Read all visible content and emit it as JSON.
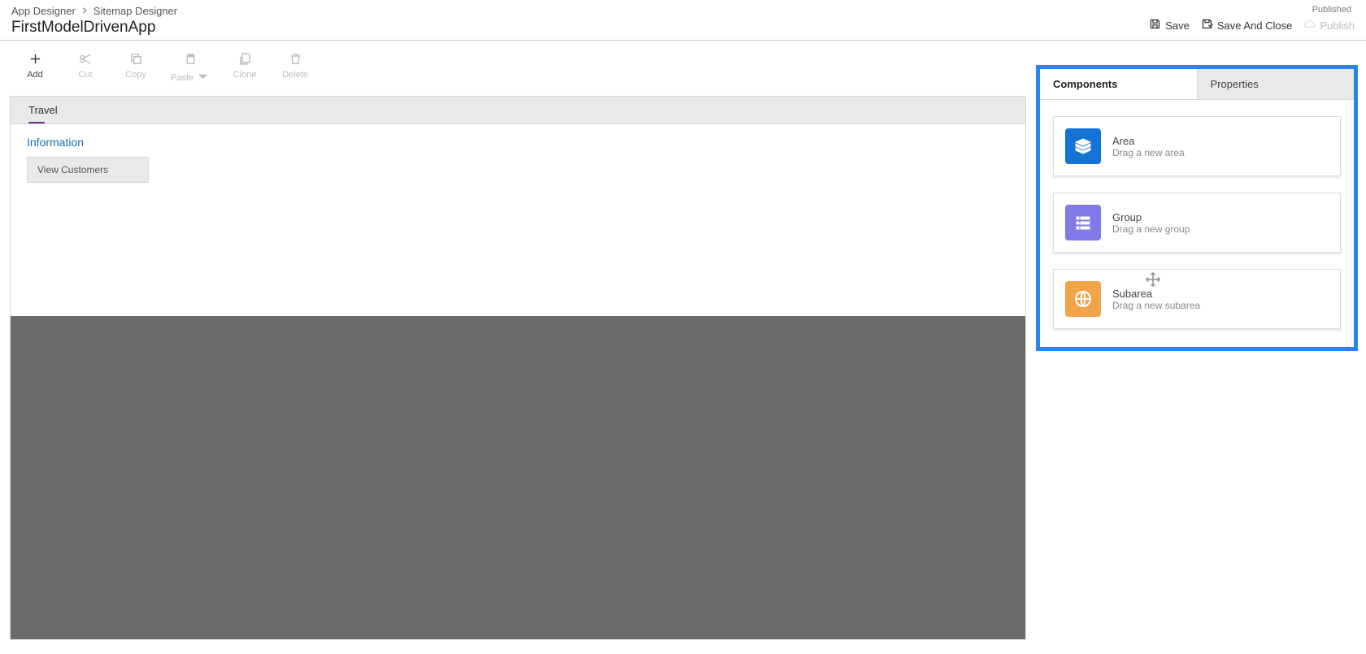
{
  "breadcrumb": {
    "root": "App Designer",
    "current": "Sitemap Designer"
  },
  "app_title": "FirstModelDrivenApp",
  "status": "Published",
  "header_buttons": {
    "save": "Save",
    "save_close": "Save And Close",
    "publish": "Publish"
  },
  "toolbar": {
    "add": "Add",
    "cut": "Cut",
    "copy": "Copy",
    "paste": "Paste",
    "clone": "Clone",
    "delete": "Delete"
  },
  "sitemap": {
    "area": "Travel",
    "group": "Information",
    "subarea": "View Customers"
  },
  "sidepanel": {
    "tabs": {
      "components": "Components",
      "properties": "Properties"
    },
    "components": [
      {
        "key": "area",
        "title": "Area",
        "desc": "Drag a new area",
        "icon": "area-layers-icon",
        "color": "blue"
      },
      {
        "key": "group",
        "title": "Group",
        "desc": "Drag a new group",
        "icon": "group-list-icon",
        "color": "purple"
      },
      {
        "key": "subarea",
        "title": "Subarea",
        "desc": "Drag a new subarea",
        "icon": "globe-icon",
        "color": "orange"
      }
    ]
  }
}
